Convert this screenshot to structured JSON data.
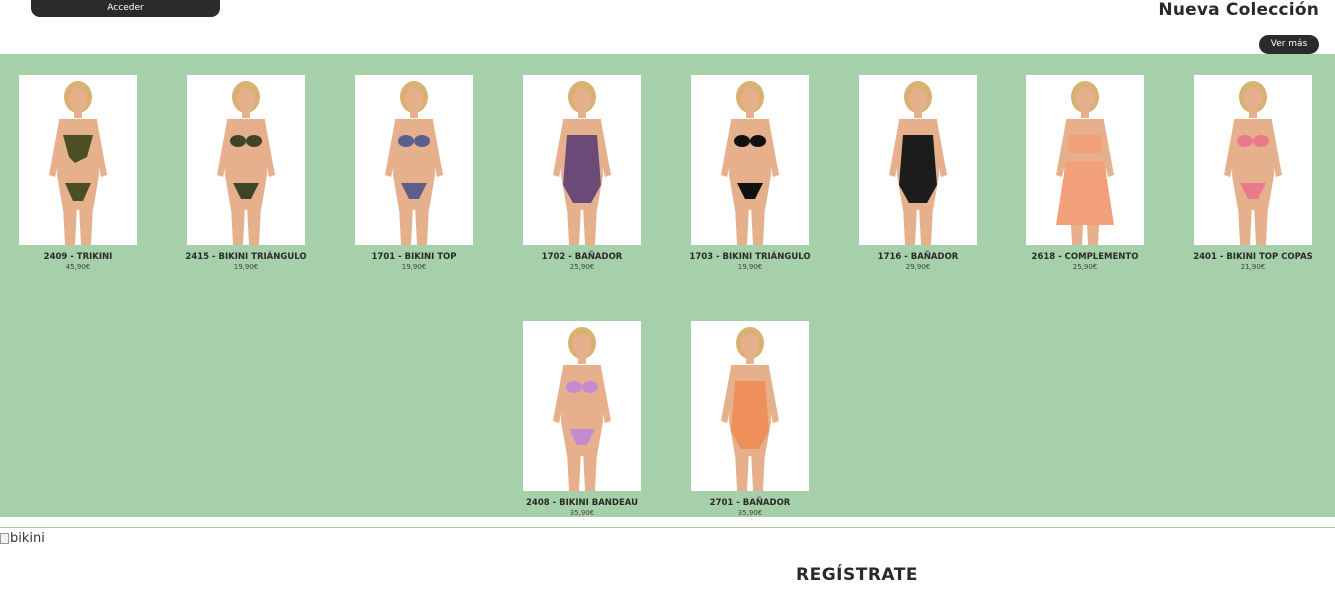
{
  "header": {
    "login_label": "Acceder",
    "collection_title": "Nueva Colección",
    "more_label": "Ver más"
  },
  "products": [
    {
      "name": "2409 - TRIKINI",
      "price": "45,90€",
      "swim_color": "#4b4f23",
      "style": "trikini"
    },
    {
      "name": "2415 - BIKINI TRIÁNGULO",
      "price": "19,90€",
      "swim_color": "#3f4526",
      "style": "bikini"
    },
    {
      "name": "1701 - BIKINI TOP",
      "price": "19,90€",
      "swim_color": "#5a5f8c",
      "style": "bikini"
    },
    {
      "name": "1702 - BAÑADOR",
      "price": "25,90€",
      "swim_color": "#6b4a7a",
      "style": "swimsuit"
    },
    {
      "name": "1703 - BIKINI TRIÁNGULO",
      "price": "19,90€",
      "swim_color": "#111111",
      "style": "bikini"
    },
    {
      "name": "1716 - BAÑADOR",
      "price": "29,90€",
      "swim_color": "#1c1c1c",
      "style": "swimsuit"
    },
    {
      "name": "2618 - COMPLEMENTO",
      "price": "25,90€",
      "swim_color": "#f2a07a",
      "style": "dress"
    },
    {
      "name": "2401 - BIKINI TOP COPAS",
      "price": "21,90€",
      "swim_color": "#e87a8c",
      "style": "bikini"
    },
    {
      "name": "2408 - BIKINI BANDEAU",
      "price": "35,90€",
      "swim_color": "#c58ad1",
      "style": "bikini"
    },
    {
      "name": "2701 - BAÑADOR",
      "price": "35,90€",
      "swim_color": "#ef8f5a",
      "style": "swimsuit"
    }
  ],
  "banner": {
    "broken_image_alt": "bikini"
  },
  "register": {
    "title": "REGÍSTRATE"
  },
  "colors": {
    "grid_background": "#a5d0a9",
    "button_dark": "#2b2b2b"
  }
}
